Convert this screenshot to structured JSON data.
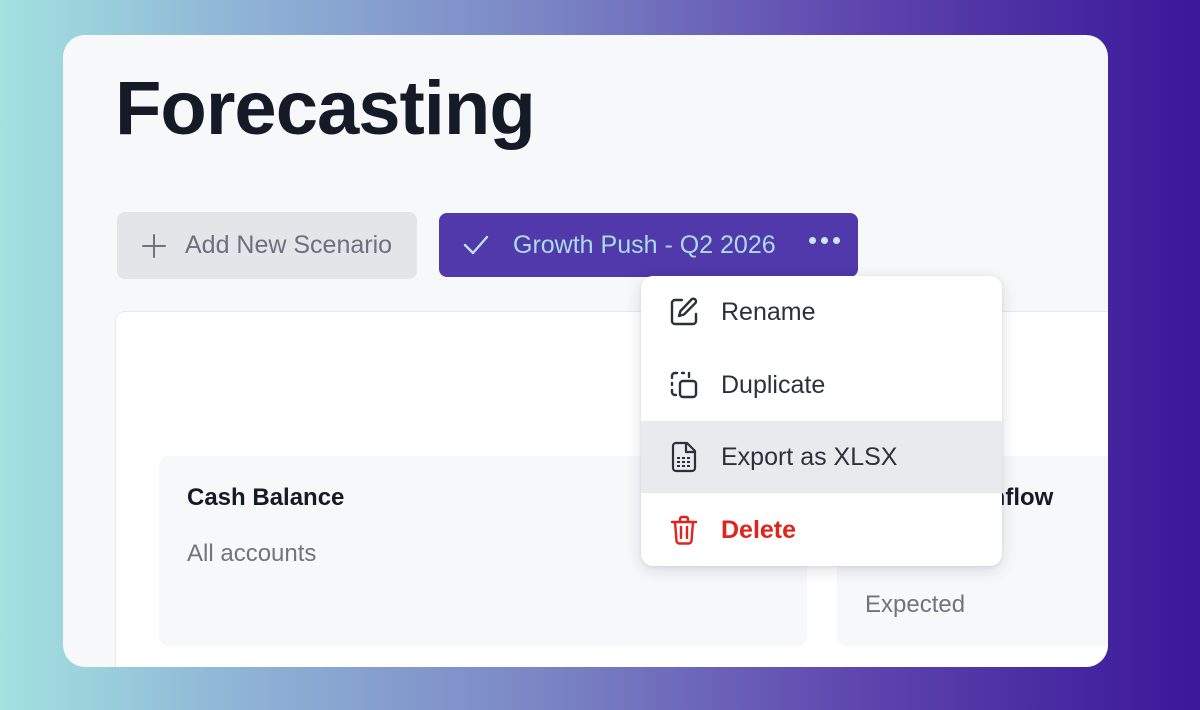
{
  "page": {
    "title": "Forecasting"
  },
  "toolbar": {
    "add_scenario_label": "Add New Scenario",
    "active_scenario_label": "Growth Push - Q2 2026"
  },
  "context_menu": {
    "items": [
      {
        "label": "Rename",
        "icon": "edit-icon"
      },
      {
        "label": "Duplicate",
        "icon": "duplicate-icon"
      },
      {
        "label": "Export as XLSX",
        "icon": "spreadsheet-file-icon",
        "highlighted": true
      },
      {
        "label": "Delete",
        "icon": "trash-icon",
        "destructive": true
      }
    ]
  },
  "cards": [
    {
      "title": "Cash Balance",
      "subtitle": "All accounts"
    },
    {
      "title": "Inflow",
      "subtitle": "Expected"
    }
  ],
  "colors": {
    "accent": "#5138ab",
    "accent_text": "#a9dde8",
    "danger": "#e0231b",
    "menu_highlight": "#e9eaed"
  }
}
